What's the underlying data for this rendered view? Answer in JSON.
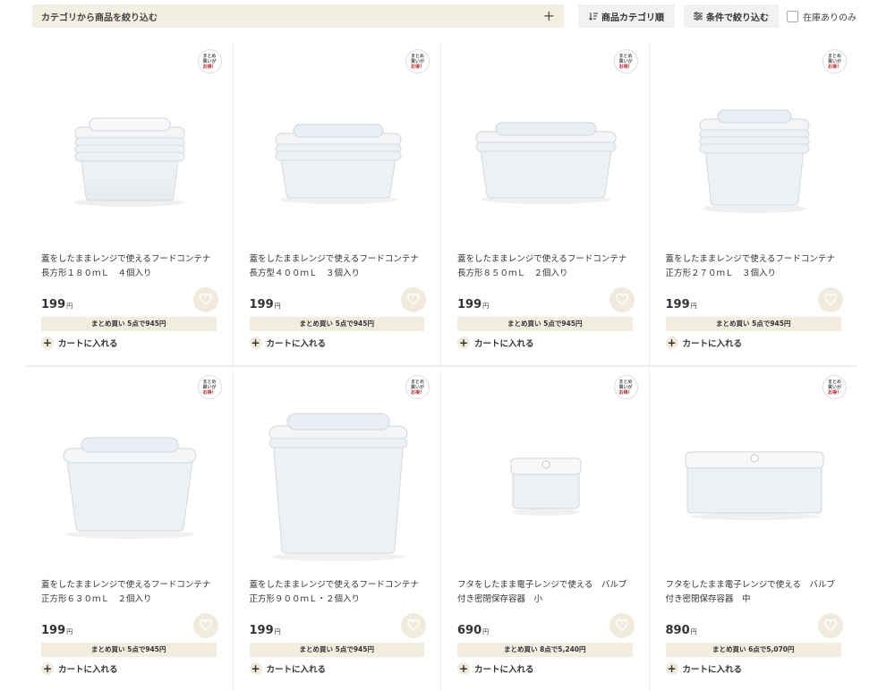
{
  "toolbar": {
    "category_filter_label": "カテゴリから商品を絞り込む",
    "sort_label": "商品カテゴリ順",
    "condition_label": "条件で絞り込む",
    "in_stock_label": "在庫ありのみ",
    "in_stock_checked": false
  },
  "badge": {
    "line1": "まとめ",
    "line2": "買いが",
    "line3": "お得！"
  },
  "cart_label": "カートに入れる",
  "colors": {
    "beige": "#f1ebdd",
    "bulk_bg": "#f3ede0",
    "filter_bg": "#f4efe3",
    "badge_red": "#a22222"
  },
  "products": [
    {
      "name": "蓋をしたままレンジで使えるフードコンテナ\n長方形１８０ｍＬ　４個入り",
      "price": "199",
      "yen": "円",
      "bulk": "まとめ買い 5点で945円",
      "image": "rect-stack-4-container"
    },
    {
      "name": "蓋をしたままレンジで使えるフードコンテナ\n長方型４００ｍＬ　３個入り",
      "price": "199",
      "yen": "円",
      "bulk": "まとめ買い 5点で945円",
      "image": "rect-stack-3-container"
    },
    {
      "name": "蓋をしたままレンジで使えるフードコンテナ\n長方形８５０ｍＬ　２個入り",
      "price": "199",
      "yen": "円",
      "bulk": "まとめ買い 5点で945円",
      "image": "rect-wide-container"
    },
    {
      "name": "蓋をしたままレンジで使えるフードコンテナ\n正方形２７０ｍＬ　３個入り",
      "price": "199",
      "yen": "円",
      "bulk": "まとめ買い 5点で945円",
      "image": "square-stack-3-container"
    },
    {
      "name": "蓋をしたままレンジで使えるフードコンテナ\n正方形６３０ｍＬ　２個入り",
      "price": "199",
      "yen": "円",
      "bulk": "まとめ買い 5点で945円",
      "image": "square-630-container"
    },
    {
      "name": "蓋をしたままレンジで使えるフードコンテナ\n正方形９００ｍＬ・２個入り",
      "price": "199",
      "yen": "円",
      "bulk": "まとめ買い 5点で945円",
      "image": "square-900-container"
    },
    {
      "name": "フタをしたまま電子レンジで使える　バルブ\n付き密閉保存容器　小",
      "price": "690",
      "yen": "円",
      "bulk": "まとめ買い 8点で5,240円",
      "image": "valve-container-small"
    },
    {
      "name": "フタをしたまま電子レンジで使える　バルブ\n付き密閉保存容器　中",
      "price": "890",
      "yen": "円",
      "bulk": "まとめ買い 6点で5,070円",
      "image": "valve-container-medium"
    }
  ]
}
